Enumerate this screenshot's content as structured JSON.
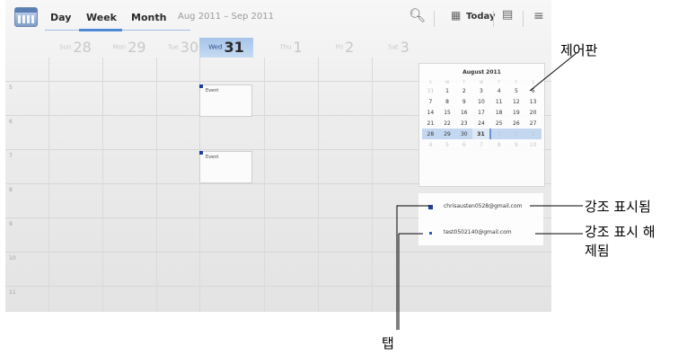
{
  "toolbar": {
    "tabs": [
      {
        "label": "Day"
      },
      {
        "label": "Week"
      },
      {
        "label": "Month"
      }
    ],
    "date_range": "Aug 2011 – Sep 2011",
    "today_label": "Today",
    "icons": [
      "calendar-app-icon",
      "search-icon",
      "today-icon",
      "add-event-icon",
      "menu-icon"
    ]
  },
  "days": [
    {
      "dow": "Sun",
      "num": "28"
    },
    {
      "dow": "Mon",
      "num": "29"
    },
    {
      "dow": "Tue",
      "num": "30"
    },
    {
      "dow": "Wed",
      "num": "31",
      "today": true
    },
    {
      "dow": "Thu",
      "num": "1"
    },
    {
      "dow": "Fri",
      "num": "2"
    },
    {
      "dow": "Sat",
      "num": "3"
    }
  ],
  "hours": [
    "5",
    "6",
    "7",
    "8",
    "9",
    "10",
    "11"
  ],
  "events": [
    {
      "label": "Event"
    },
    {
      "label": "Event"
    }
  ],
  "mini_calendar": {
    "title": "August 2011",
    "weekday_headers": [
      "S",
      "M",
      "T",
      "W",
      "T",
      "F",
      "S"
    ],
    "weeks": [
      [
        "31",
        "1",
        "2",
        "3",
        "4",
        "5",
        "6"
      ],
      [
        "7",
        "8",
        "9",
        "10",
        "11",
        "12",
        "13"
      ],
      [
        "14",
        "15",
        "16",
        "17",
        "18",
        "19",
        "20"
      ],
      [
        "21",
        "22",
        "23",
        "24",
        "25",
        "26",
        "27"
      ],
      [
        "28",
        "29",
        "30",
        "31",
        "1",
        "2",
        "3"
      ],
      [
        "4",
        "5",
        "6",
        "7",
        "8",
        "9",
        "10"
      ]
    ]
  },
  "calendars": [
    {
      "email": "chrisausten0528@gmail.com",
      "highlighted": true
    },
    {
      "email": "test0502140@gmail.com",
      "highlighted": false
    }
  ],
  "callouts": {
    "control_panel": "제어판",
    "highlighted": "강조 표시됨",
    "unhighlighted": "강조 표시 해제됨",
    "tab": "탭"
  },
  "colors": {
    "accent": "#4d8ad6",
    "today_column": "#a6c4ea",
    "event_marker": "#1d3f9a"
  }
}
